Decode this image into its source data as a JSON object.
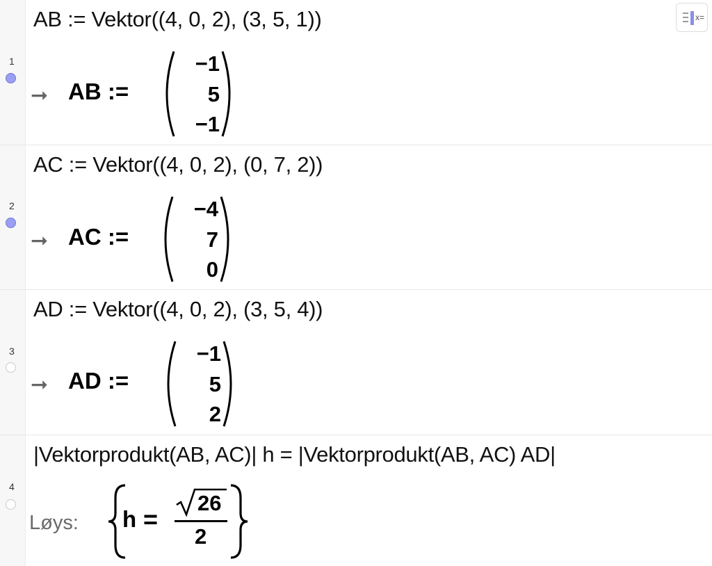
{
  "toolbar": {
    "toggle_text": "x="
  },
  "rows": [
    {
      "number": "1",
      "active": true,
      "input": "AB := Vektor((4, 0, 2), (3, 5, 1))",
      "output_label": "AB :=",
      "vector": [
        "−1",
        "5",
        "−1"
      ]
    },
    {
      "number": "2",
      "active": true,
      "input": "AC := Vektor((4, 0, 2), (0, 7, 2))",
      "output_label": "AC :=",
      "vector": [
        "−4",
        "7",
        "0"
      ]
    },
    {
      "number": "3",
      "active": false,
      "input": "AD := Vektor((4, 0, 2), (3, 5, 4))",
      "output_label": "AD :=",
      "vector": [
        "−1",
        "5",
        "2"
      ]
    },
    {
      "number": "4",
      "active": false,
      "input": "|Vektorprodukt(AB, AC)| h  =  |Vektorprodukt(AB, AC) AD|",
      "solve_label": "Løys:",
      "solution": {
        "var": "h",
        "eq": "=",
        "numerator": "26",
        "denominator": "2"
      }
    }
  ],
  "icons": {
    "output_arrow": "right-arrow-icon"
  }
}
